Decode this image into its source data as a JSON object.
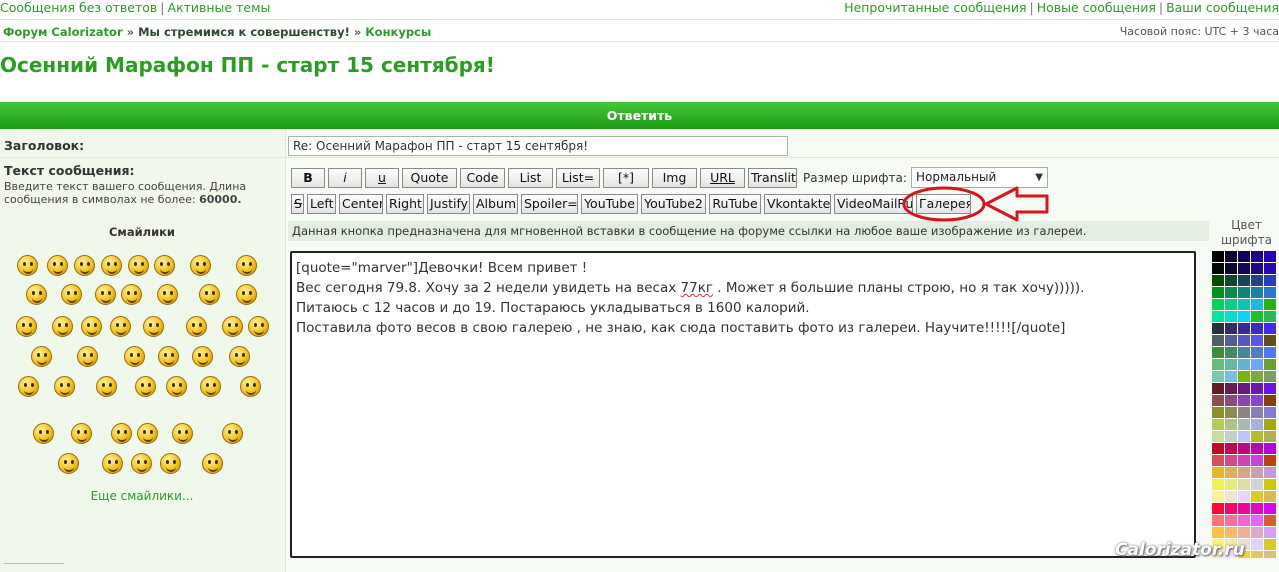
{
  "top_links": {
    "left": [
      "Сообщения без ответов",
      "Активные темы"
    ],
    "right": [
      "Непрочитанные сообщения",
      "Новые сообщения",
      "Ваши сообщения"
    ]
  },
  "breadcrumb": {
    "items": [
      "Форум Calorizator",
      "Мы стремимся к совершенству!",
      "Конкурсы"
    ],
    "arrow": "»"
  },
  "timezone": "Часовой пояс: UTC + 3 часа",
  "topic_title": "Осенний Марафон ПП - старт 15 сентября!",
  "reply_bar": "Ответить",
  "subject": {
    "label": "Заголовок:",
    "value": "Re: Осенний Марафон ПП - старт 15 сентября!"
  },
  "message": {
    "label": "Текст сообщения:",
    "hint": "Введите текст вашего сообщения. Длина сообщения в символах не более:",
    "max_length": "60000.",
    "text_before": "[quote=\"marver\"]Девочки! Всем привет !\nВес сегодня 79.8. Хочу за 2 недели увидеть на весах ",
    "text_underlined": "77кг",
    "text_after": " . Может я большие планы строю, но я так хочу))))).\nПитаюсь с 12 часов и до 19. Постараюсь укладываться в 1600 калорий.\nПоставила фото весов в свою галерею , не знаю, как сюда поставить фото из галереи. Научите!!!!![/quote]"
  },
  "smileys": {
    "heading": "Смайлики",
    "more_link": "Еще смайлики..."
  },
  "toolbar": {
    "row1": [
      "B",
      "i",
      "u",
      "Quote",
      "Code",
      "List",
      "List=",
      "[*]",
      "Img",
      "URL",
      "Translit"
    ],
    "row2": [
      "S",
      "Left",
      "Center",
      "Right",
      "Justify",
      "Album",
      "Spoiler=",
      "YouTube",
      "YouTube2",
      "RuTube",
      "Vkontakte",
      "VideoMailRu",
      "Галерея"
    ]
  },
  "font_size": {
    "label": "Размер шрифта:",
    "selected": "Нормальный"
  },
  "help_text": "Данная кнопка предназначена для мгновенной вставки в сообщение на форуме ссылки на любое ваше изображение из галереи.",
  "color_panel": {
    "label": "Цвет шрифта"
  },
  "annotation_color": "#d9141e",
  "accent_green": "#2a9d22",
  "watermark": "Calorizator.ru"
}
